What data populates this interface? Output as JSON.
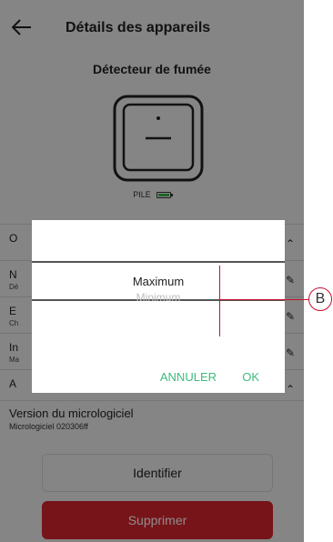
{
  "header": {
    "title": "Détails des appareils"
  },
  "device": {
    "name": "Détecteur de fumée",
    "battery_label": "PILE"
  },
  "rows": [
    {
      "main": "O",
      "sub": ""
    },
    {
      "main": "N",
      "sub": "Dé"
    },
    {
      "main": "E",
      "sub": "Ch"
    },
    {
      "main": "In",
      "sub": "Ma"
    },
    {
      "main": "A",
      "sub": ""
    }
  ],
  "firmware": {
    "label": "Version du micrologiciel",
    "value": "Micrologiciel 020306ff"
  },
  "buttons": {
    "identify": "Identifier",
    "delete": "Supprimer"
  },
  "dialog": {
    "options": [
      "Maximum",
      "Minimum"
    ],
    "cancel": "ANNULER",
    "ok": "OK"
  },
  "callout": {
    "label": "B"
  },
  "colors": {
    "accent": "#3dbd7d",
    "danger": "#d9262e",
    "callout": "#c8102e"
  }
}
